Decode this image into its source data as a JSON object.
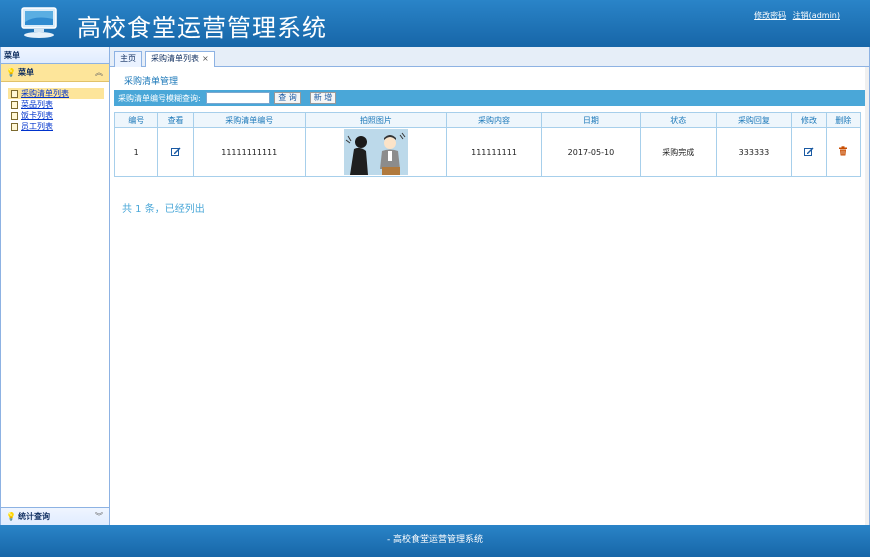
{
  "header": {
    "app_title": "高校食堂运营管理系统",
    "change_password": "修改密码",
    "logout": "注销(admin)"
  },
  "sidebar": {
    "title": "菜单",
    "panel_title": "菜单",
    "items": [
      {
        "label": "采购清单列表",
        "active": true
      },
      {
        "label": "菜品列表",
        "active": false
      },
      {
        "label": "饭卡列表",
        "active": false
      },
      {
        "label": "员工列表",
        "active": false
      }
    ],
    "bottom_panel": "统计查询"
  },
  "tabs": [
    {
      "label": "主页"
    },
    {
      "label": "采购清单列表",
      "closable": true
    }
  ],
  "page": {
    "title": "采购清单管理",
    "search_label": "采购清单编号模糊查询:",
    "search_value": "",
    "query_button": "查 询",
    "add_button": "新 增"
  },
  "table": {
    "columns": [
      "编号",
      "查看",
      "采购清单编号",
      "拍照图片",
      "采购内容",
      "日期",
      "状态",
      "采购回复",
      "修改",
      "删除"
    ],
    "rows": [
      {
        "id": "1",
        "code": "11111111111",
        "content": "111111111",
        "date": "2017-05-10",
        "status": "采购完成",
        "reply": "333333"
      }
    ]
  },
  "summary": "共 1 条，已经列出",
  "footer": "- 高校食堂运营管理系统",
  "colors": {
    "header_blue": "#1b74b9",
    "accent_blue": "#4aa7d8",
    "active_yellow": "#fde59a",
    "delete_orange": "#c84c00"
  }
}
